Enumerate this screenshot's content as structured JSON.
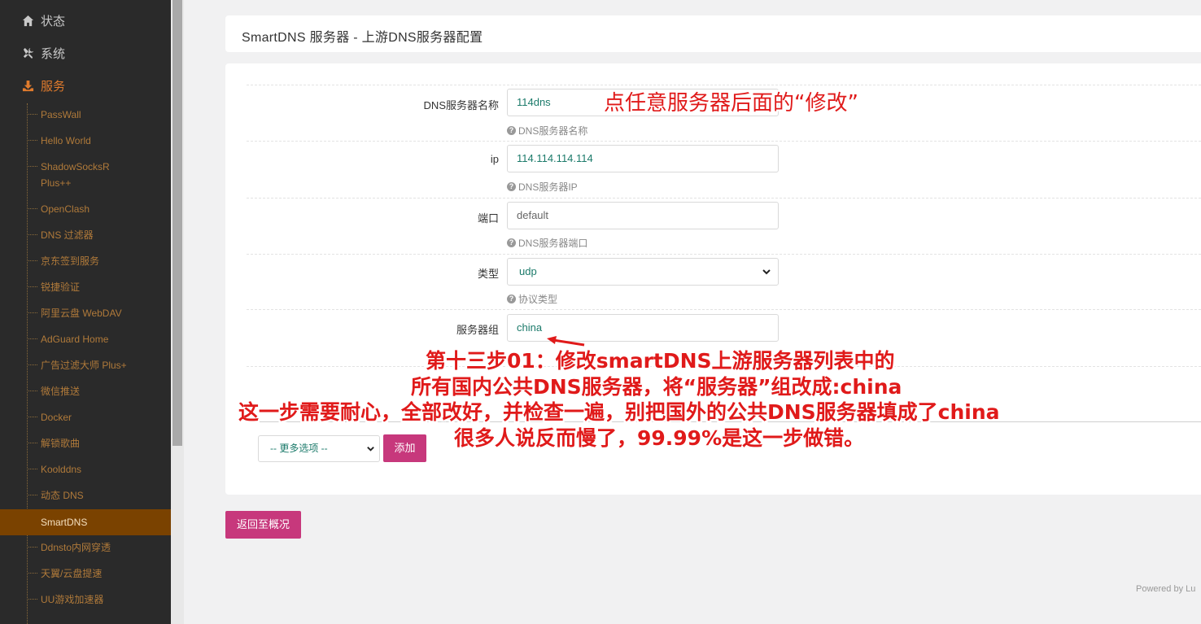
{
  "sidebar": {
    "top_items": [
      {
        "label": "状态",
        "icon": "home-icon"
      },
      {
        "label": "系统",
        "icon": "tools-icon"
      },
      {
        "label": "服务",
        "icon": "download-icon"
      }
    ],
    "services": [
      "PassWall",
      "Hello World",
      "ShadowSocksR",
      "Plus++",
      "OpenClash",
      "DNS 过滤器",
      "京东签到服务",
      "锐捷验证",
      "阿里云盘 WebDAV",
      "AdGuard Home",
      "广告过滤大师 Plus+",
      "微信推送",
      "Docker",
      "解锁歌曲",
      "Koolddns",
      "动态 DNS",
      "SmartDNS",
      "Ddnsto内网穿透",
      "天翼/云盘提速",
      "UU游戏加速器"
    ]
  },
  "header": {
    "title": "SmartDNS 服务器 - 上游DNS服务器配置"
  },
  "form": {
    "name": {
      "label": "DNS服务器名称",
      "value": "114dns",
      "hint": "DNS服务器名称"
    },
    "ip": {
      "label": "ip",
      "value": "114.114.114.114",
      "hint": "DNS服务器IP"
    },
    "port": {
      "label": "端口",
      "value": "default",
      "hint": "DNS服务器端口"
    },
    "type": {
      "label": "类型",
      "value": "udp",
      "hint": "协议类型"
    },
    "group": {
      "label": "服务器组",
      "value": "china"
    }
  },
  "actions": {
    "more_options": "-- 更多选项 --",
    "add": "添加",
    "back": "返回至概况"
  },
  "footer": {
    "powered": "Powered by Lu"
  },
  "annotations": {
    "top": "点任意服务器后面的“修改”",
    "line1": "第十三步01：修改smartDNS上游服务器列表中的",
    "line2": "所有国内公共DNS服务器，将“服务器”组改成:china",
    "line3": "这一步需要耐心，全部改好，并检查一遍，别把国外的公共DNS服务器填成了china",
    "line4": "很多人说反而慢了，99.99%是这一步做错。"
  },
  "colors": {
    "accent": "#c7387c",
    "sidebar_active": "#7a4200",
    "annotation": "#e01a1a"
  }
}
